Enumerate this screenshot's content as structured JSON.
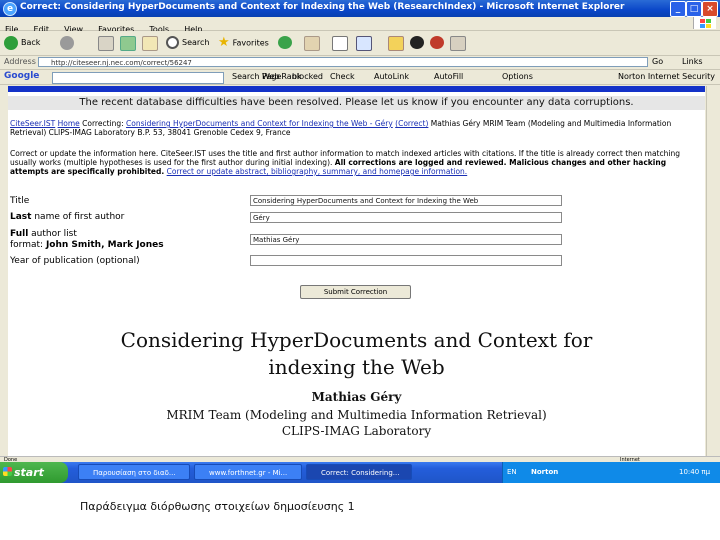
{
  "window": {
    "title": "Correct: Considering HyperDocuments and Context for Indexing the Web (ResearchIndex) - Microsoft Internet Explorer",
    "icon": "ie-icon"
  },
  "menu": [
    "File",
    "Edit",
    "View",
    "Favorites",
    "Tools",
    "Help"
  ],
  "toolbar": {
    "back": "Back",
    "search": "Search",
    "favorites": "Favorites"
  },
  "address": {
    "label": "Address",
    "url": "http://citeseer.nj.nec.com/correct/56247",
    "go": "Go",
    "links": "Links"
  },
  "google_bar": {
    "logo": "Google",
    "buttons": [
      "Search Web",
      "PageRank",
      "blocked",
      "Check",
      "AutoLink",
      "AutoFill",
      "Options"
    ],
    "norton": "Norton Internet Security"
  },
  "page": {
    "notice": "The recent database difficulties have been resolved. Please let us know if you encounter any data corruptions.",
    "nav": {
      "citeseer": "CiteSeer.IST",
      "home": "Home",
      "correcting_label": "Correcting:",
      "correcting_link": "Considering HyperDocuments and Context for Indexing the Web - Géry",
      "correct_link": "(Correct)",
      "rest": "Mathias Géry MRIM Team (Modeling and Multimedia Information Retrieval) CLIPS-IMAG Laboratory B.P. 53, 38041 Grenoble Cedex 9, France"
    },
    "description": {
      "part1": "Correct or update the information here. CiteSeer.IST uses the title and first author information to match indexed articles with citations. If the title is already correct then matching usually works (multiple hypotheses is used for the first author during initial indexing).",
      "bold": "All corrections are logged and reviewed. Malicious changes and other hacking attempts are specifically prohibited.",
      "link": "Correct or update abstract, bibliography, summary, and homepage information."
    },
    "form": {
      "title_label": "Title",
      "title_value": "Considering HyperDocuments and Context for Indexing the Web",
      "last_bold": "Last",
      "last_rest": "name of first author",
      "last_value": "Géry",
      "full_bold": "Full",
      "full_rest": "author list",
      "format_prefix": "format:",
      "format_example": "John Smith, Mark Jones",
      "full_value": "Mathias Géry",
      "year_label": "Year of publication (optional)",
      "year_value": "",
      "submit": "Submit Correction"
    },
    "paper": {
      "title_line1": "Considering HyperDocuments and Context for",
      "title_line2": "indexing the Web",
      "author": "Mathias Géry",
      "aff_line1": "MRIM Team (Modeling and Multimedia Information Retrieval)",
      "aff_line2": "CLIPS-IMAG Laboratory"
    }
  },
  "status": {
    "left": "Done",
    "right": "Internet"
  },
  "taskbar": {
    "start": "start",
    "tasks": [
      "Παρουσίαση στο διαδ...",
      "www.forthnet.gr - Mi...",
      "Correct: Considering..."
    ],
    "lang": "EN",
    "norton": "Norton",
    "clock": "10:40 πμ"
  },
  "caption": "Παράδειγμα διόρθωσης στοιχείων δημοσίευσης 1"
}
